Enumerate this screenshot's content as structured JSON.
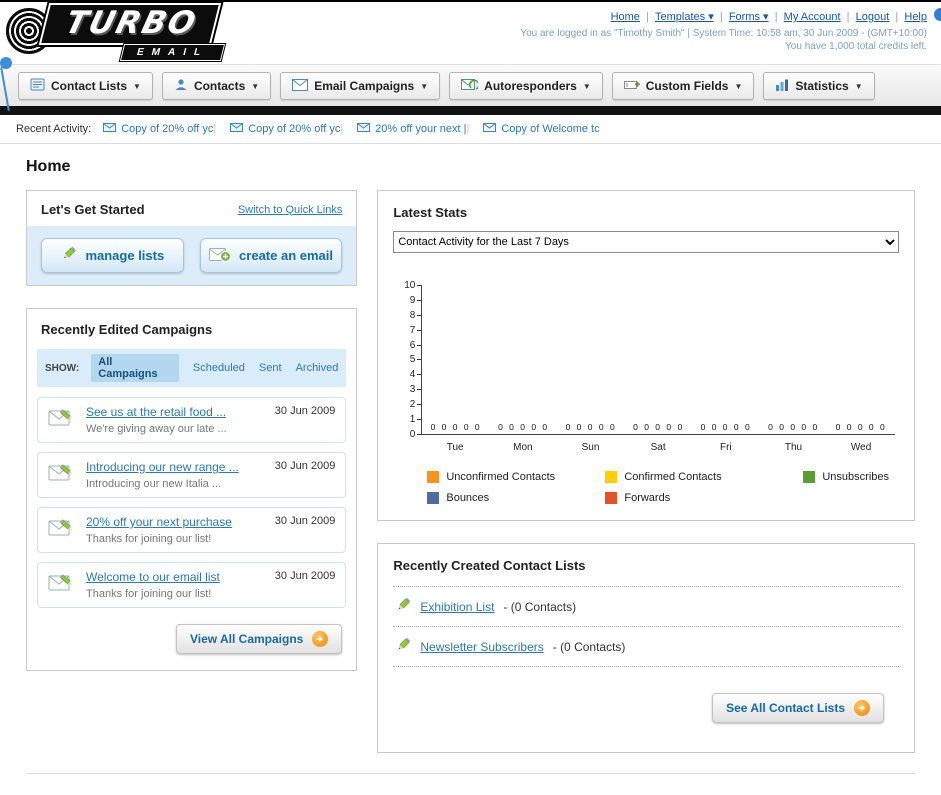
{
  "header": {
    "logo_line1": "TURBO",
    "logo_line2": "EMAIL",
    "nav_links": [
      "Home",
      "Templates ▾",
      "Forms ▾",
      "My Account",
      "Logout",
      "Help"
    ],
    "login_info": "You are logged in as \"Timothy Smith\" | System Time: 10:58 am, 30 Jun 2009 - (GMT+10:00)",
    "credits": "You have 1,000 total credits left."
  },
  "nav": {
    "tabs": [
      {
        "label": "Contact Lists"
      },
      {
        "label": "Contacts"
      },
      {
        "label": "Email Campaigns"
      },
      {
        "label": "Autoresponders"
      },
      {
        "label": "Custom Fields"
      },
      {
        "label": "Statistics"
      }
    ]
  },
  "recent_activity": {
    "label": "Recent Activity:",
    "items": [
      "Copy of 20% off yc",
      "Copy of 20% off yc",
      "20% off your next |",
      "Copy of Welcome tc"
    ]
  },
  "page_title": "Home",
  "get_started": {
    "title": "Let's Get Started",
    "switch_link": "Switch to Quick Links",
    "manage_lists_label": "manage lists",
    "create_email_label": "create an email"
  },
  "campaigns": {
    "title": "Recently Edited Campaigns",
    "show_label": "SHOW:",
    "filters": [
      "All Campaigns",
      "Scheduled",
      "Sent",
      "Archived"
    ],
    "active_filter": "All Campaigns",
    "items": [
      {
        "title": "See us at the retail food ...",
        "subtitle": "We're giving away our late ...",
        "date": "30 Jun 2009"
      },
      {
        "title": "Introducing our new range ...",
        "subtitle": "Introducing our new Italia ...",
        "date": "30 Jun 2009"
      },
      {
        "title": "20% off your next purchase",
        "subtitle": "Thanks for joining our list!",
        "date": "30 Jun 2009"
      },
      {
        "title": "Welcome to our email list",
        "subtitle": "Thanks for joining our list!",
        "date": "30 Jun 2009"
      }
    ],
    "view_all_label": "View All Campaigns"
  },
  "stats": {
    "title": "Latest Stats",
    "dropdown_value": "Contact Activity for the Last 7 Days",
    "chart_data": {
      "type": "bar",
      "categories": [
        "Tue",
        "Mon",
        "Sun",
        "Sat",
        "Fri",
        "Thu",
        "Wed"
      ],
      "series": [
        {
          "name": "Unconfirmed Contacts",
          "color": "#f7941d",
          "values": [
            0,
            0,
            0,
            0,
            0,
            0,
            0
          ]
        },
        {
          "name": "Confirmed Contacts",
          "color": "#ffcc00",
          "values": [
            0,
            0,
            0,
            0,
            0,
            0,
            0
          ]
        },
        {
          "name": "Unsubscribes",
          "color": "#5b9e30",
          "values": [
            0,
            0,
            0,
            0,
            0,
            0,
            0
          ]
        },
        {
          "name": "Bounces",
          "color": "#4f6d9e",
          "values": [
            0,
            0,
            0,
            0,
            0,
            0,
            0
          ]
        },
        {
          "name": "Forwards",
          "color": "#e8502a",
          "values": [
            0,
            0,
            0,
            0,
            0,
            0,
            0
          ]
        }
      ],
      "ylim": [
        0,
        10
      ],
      "yticks": [
        10,
        9,
        8,
        7,
        6,
        5,
        4,
        3,
        2,
        1,
        0
      ],
      "legend_position": "bottom",
      "grid": false
    }
  },
  "contact_lists": {
    "title": "Recently Created Contact Lists",
    "items": [
      {
        "name": "Exhibition List",
        "suffix": "- (0 Contacts)"
      },
      {
        "name": "Newsletter Subscribers",
        "suffix": "- (0 Contacts)"
      }
    ],
    "see_all_label": "See All Contact Lists"
  }
}
